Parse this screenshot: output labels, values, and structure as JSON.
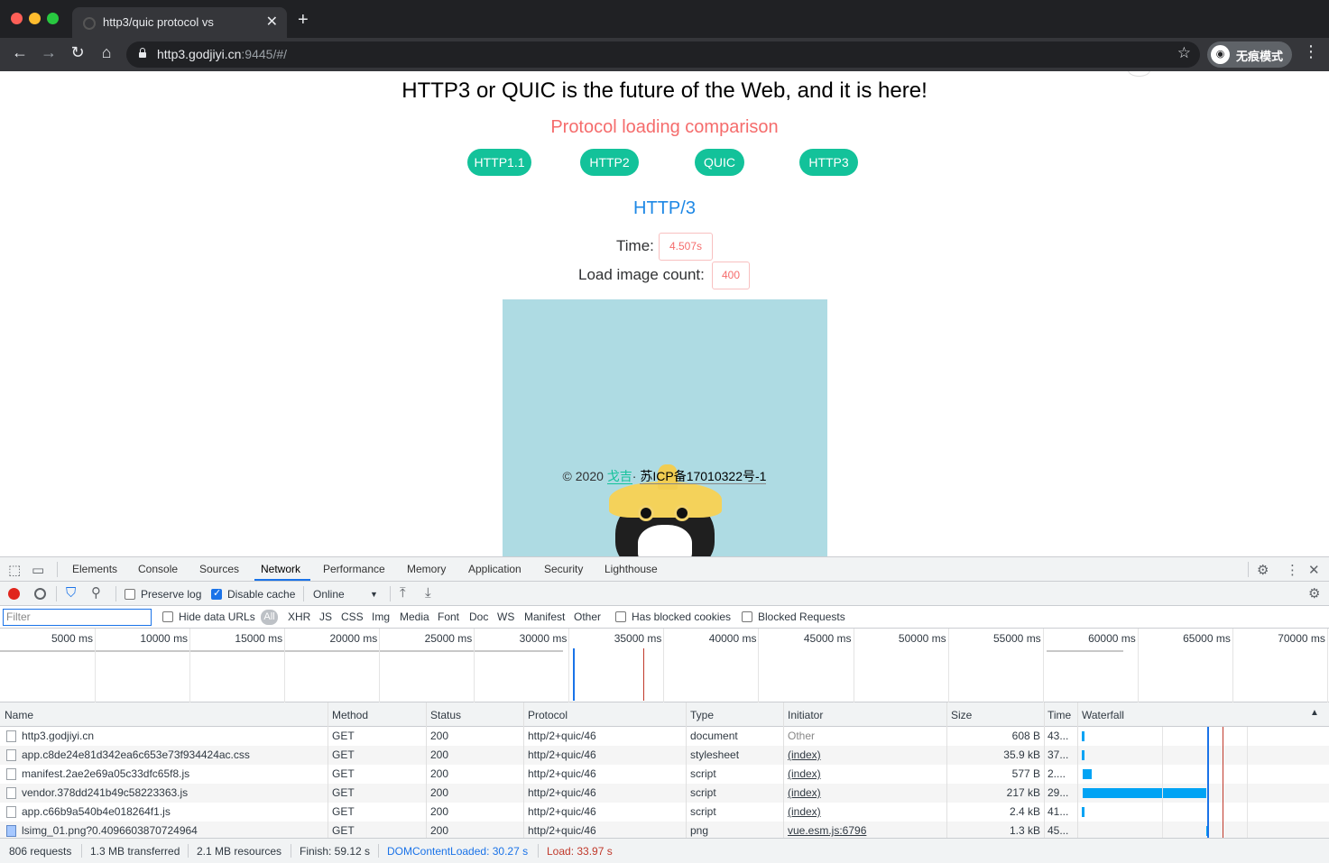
{
  "browser": {
    "tab_title": "http3/quic protocol vs",
    "tab_close": "✕",
    "new_tab": "+",
    "url_host": "http3.godjiyi.cn",
    "url_rest": ":9445/#/",
    "incognito_label": "无痕模式"
  },
  "page": {
    "title": "HTTP3 or QUIC is the future of the Web, and it is here!",
    "subtitle": "Protocol loading comparison",
    "protocol_buttons": [
      "HTTP1.1",
      "HTTP2",
      "QUIC",
      "HTTP3"
    ],
    "current_protocol": "HTTP/3",
    "time_label": "Time:",
    "time_value": "4.507s",
    "count_label": "Load image count:",
    "count_value": "400",
    "footer_prefix": "© 2020",
    "footer_author": "戈吉",
    "footer_dot": "·",
    "footer_icp": "苏ICP备17010322号-1",
    "colors": {
      "accent_green": "#13c29a",
      "accent_red": "#f56c6c",
      "accent_blue": "#1e88e5"
    }
  },
  "devtools": {
    "tabs": [
      "Elements",
      "Console",
      "Sources",
      "Network",
      "Performance",
      "Memory",
      "Application",
      "Security",
      "Lighthouse"
    ],
    "active_tab": "Network",
    "toolbar": {
      "preserve_log": "Preserve log",
      "disable_cache": "Disable cache",
      "throttle": "Online"
    },
    "filter": {
      "placeholder": "Filter",
      "hide_data_urls": "Hide data URLs",
      "all": "All",
      "types": [
        "XHR",
        "JS",
        "CSS",
        "Img",
        "Media",
        "Font",
        "Doc",
        "WS",
        "Manifest",
        "Other"
      ],
      "has_blocked_cookies": "Has blocked cookies",
      "blocked_requests": "Blocked Requests"
    },
    "overview_ticks": [
      "5000 ms",
      "10000 ms",
      "15000 ms",
      "20000 ms",
      "25000 ms",
      "30000 ms",
      "35000 ms",
      "40000 ms",
      "45000 ms",
      "50000 ms",
      "55000 ms",
      "60000 ms",
      "65000 ms",
      "70000 ms"
    ],
    "columns": [
      "Name",
      "Method",
      "Status",
      "Protocol",
      "Type",
      "Initiator",
      "Size",
      "Time",
      "Waterfall"
    ],
    "rows": [
      {
        "name": "http3.godjiyi.cn",
        "method": "GET",
        "status": "200",
        "protocol": "http/2+quic/46",
        "type": "document",
        "initiator": "Other",
        "size": "608 B",
        "time": "43..."
      },
      {
        "name": "app.c8de24e81d342ea6c653e73f934424ac.css",
        "method": "GET",
        "status": "200",
        "protocol": "http/2+quic/46",
        "type": "stylesheet",
        "initiator": "(index)",
        "size": "35.9 kB",
        "time": "37..."
      },
      {
        "name": "manifest.2ae2e69a05c33dfc65f8.js",
        "method": "GET",
        "status": "200",
        "protocol": "http/2+quic/46",
        "type": "script",
        "initiator": "(index)",
        "size": "577 B",
        "time": "2...."
      },
      {
        "name": "vendor.378dd241b49c58223363.js",
        "method": "GET",
        "status": "200",
        "protocol": "http/2+quic/46",
        "type": "script",
        "initiator": "(index)",
        "size": "217 kB",
        "time": "29..."
      },
      {
        "name": "app.c66b9a540b4e018264f1.js",
        "method": "GET",
        "status": "200",
        "protocol": "http/2+quic/46",
        "type": "script",
        "initiator": "(index)",
        "size": "2.4 kB",
        "time": "41..."
      },
      {
        "name": "lsimg_01.png?0.4096603870724964",
        "method": "GET",
        "status": "200",
        "protocol": "http/2+quic/46",
        "type": "png",
        "initiator": "vue.esm.js:6796",
        "size": "1.3 kB",
        "time": "45..."
      }
    ],
    "status_bar": {
      "requests": "806 requests",
      "transferred": "1.3 MB transferred",
      "resources": "2.1 MB resources",
      "finish": "Finish: 59.12 s",
      "dom_content_loaded": "DOMContentLoaded: 30.27 s",
      "load": "Load: 33.97 s"
    }
  }
}
